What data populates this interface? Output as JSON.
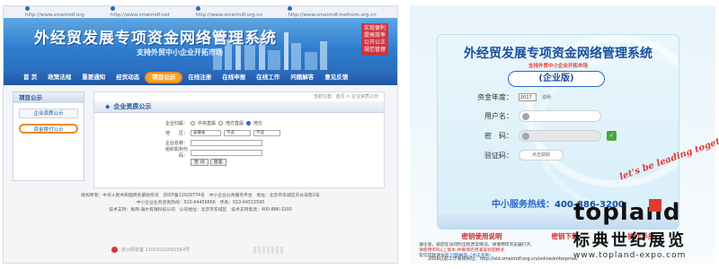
{
  "left": {
    "urls": [
      "http://www.smeimdf.org",
      "http://www.smeimdf.net",
      "http://www.smeimdf.org.cn",
      "http://www.smeimdf.mofcom.org.cn"
    ],
    "banner": {
      "title": "外经贸发展专项资金网络管理系统",
      "subtitle": "支持外贸中小企业开拓市场",
      "slogan": "实现便利 提高效率 公开公正 规范管理"
    },
    "nav": [
      "首 页",
      "政策法规",
      "重要通知",
      "经贸动态",
      "项目公示",
      "在线注册",
      "在线申报",
      "在线工作",
      "问题解答",
      "意见反馈"
    ],
    "nav_active_index": 4,
    "sidebar": {
      "title": "项目公示",
      "items": [
        "企业资质公示",
        "资金拨付公示"
      ],
      "circled_index": 1
    },
    "main": {
      "breadcrumb": "当前位置：首页 > 企业资质公示",
      "title": "企业资质公示",
      "form": {
        "level_label": "企业归属：",
        "level_options": [
          "中央直属",
          "地方直属",
          "地方"
        ],
        "level_selected": 2,
        "region_label": "地　　区：",
        "region_value": "安徽省",
        "city_value": "不选",
        "county_value": "不选",
        "company_label": "企业名称：",
        "code_label": "组织机构代码：",
        "query_button": "查 询",
        "reset_button": "重置"
      }
    },
    "footer": {
      "line1": "版权所有：中华人民共和国商务部财务司　京ICP备11029774号　中小企业公共服务平台　地址：北京市东城区东长安街2号",
      "line2": "中小企业业务咨询热线：010-64456666　传真：010-64515595",
      "line3": "技术支持：易商-海尔有限科技公司　公司地址：北京市东城区　技术支持电话：400-886-3200"
    },
    "footer_bottom": "京公网安备 11010102001564号"
  },
  "right": {
    "title": "外经贸发展专项资金网络管理系统",
    "subtitle": "支持外贸中小企业开拓市场",
    "edition": "(企业版)",
    "year_label": "资金年度：",
    "year_value": "2017",
    "year_note": "说明",
    "username_label": "用户名：",
    "password_label": "密　码：",
    "captcha_label": "验证码：",
    "captcha_placeholder": "点击获取",
    "hotline_label": "中小服务热线：",
    "hotline_number": "400-886-3200",
    "help_links": [
      "密钥使用说明",
      "密钥下载",
      "操作手册"
    ],
    "notice": {
      "line1": "请注意，如您在访问时出现异常情况，请使用IE浏览器打开。",
      "line2": "请使用IE8以上版本,并确保启用兼容视图模式",
      "line3_label": "常见问题请访问",
      "line3_link": "问题解答（点击查看）"
    },
    "url_footer": "2009以前工作系统网址：http://old.smeimdf.org.cn/online/enterprise/"
  },
  "watermark": {
    "slogan": "let's be leading together",
    "brand": "topland",
    "brand_cn": "标典世纪展览",
    "url": "www.topland-expo.com"
  }
}
